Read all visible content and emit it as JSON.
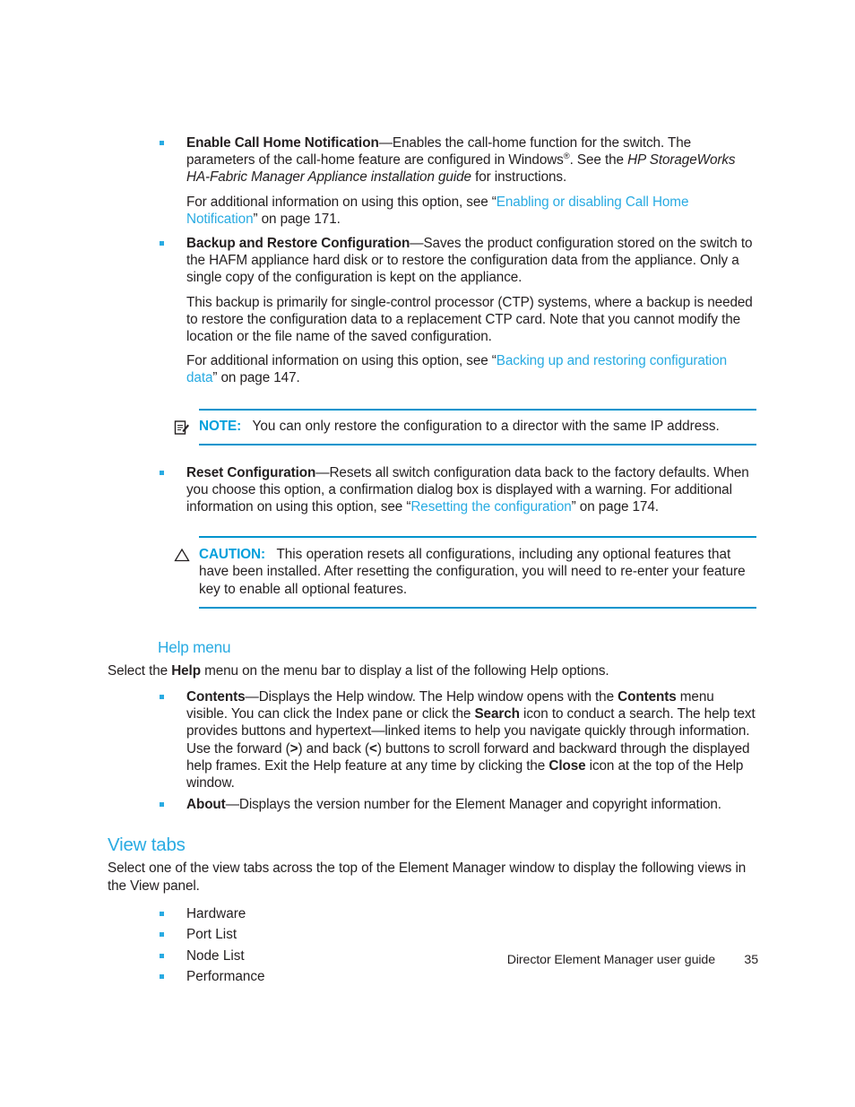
{
  "document": {
    "title": "Director Element Manager user guide",
    "page_number": "35"
  },
  "colors": {
    "link": "#29abe2",
    "heading": "#29abe2",
    "admonition_label": "#00a0dc",
    "rule": "#0094cd",
    "bullet": "#29abe2",
    "body_text": "#231f20"
  },
  "bullets": {
    "enable_call_home": {
      "term": "Enable Call Home Notification",
      "dash": "—",
      "p1_a": "Enables the call-home function for the switch. The parameters of the call-home feature are configured in Windows",
      "p1_sup": "®",
      "p1_b": ". See the ",
      "p1_italic": "HP StorageWorks HA-Fabric Manager Appliance installation guide",
      "p1_c": " for instructions.",
      "p2_a": "For additional information on using this option, see “",
      "p2_link": "Enabling or disabling Call Home Notification",
      "p2_b": "” on page 171."
    },
    "backup_restore": {
      "term": "Backup and Restore Configuration",
      "dash": "—",
      "p1": "Saves the product configuration stored on the switch to the HAFM appliance hard disk or to restore the configuration data from the appliance. Only a single copy of the configuration is kept on the appliance.",
      "p2": "This backup is primarily for single-control processor (CTP) systems, where a backup is needed to restore the configuration data to a replacement CTP card. Note that you cannot modify the location or the file name of the saved configuration.",
      "p3_a": "For additional information on using this option, see “",
      "p3_link": "Backing up and restoring configuration data",
      "p3_b": "” on page 147."
    },
    "reset_configuration": {
      "term": "Reset Configuration",
      "dash": "—",
      "p1_a": "Resets all switch configuration data back to the factory defaults. When you choose this option, a confirmation dialog box is displayed with a warning. For additional information on using this option, see “",
      "p1_link": "Resetting the configuration",
      "p1_b": "” on page 174."
    }
  },
  "note": {
    "icon": "note-document-pencil-icon",
    "label": "NOTE:",
    "text": "You can only restore the configuration to a director with the same IP address."
  },
  "caution": {
    "icon": "caution-triangle-icon",
    "label": "CAUTION:",
    "text": "This operation resets all configurations, including any optional features that have been installed. After resetting the configuration, you will need to re-enter your feature key to enable all optional features."
  },
  "help_menu": {
    "heading": "Help menu",
    "intro_a": "Select the ",
    "intro_bold": "Help",
    "intro_b": " menu on the menu bar to display a list of the following Help options.",
    "contents": {
      "term": "Contents",
      "dash": "—",
      "t1": "Displays the Help window. The Help window opens with the ",
      "b1": "Contents",
      "t2": " menu visible. You can click the Index pane or click the ",
      "b2": "Search",
      "t3": " icon to conduct a search. The help text provides buttons and hypertext—linked items to help you navigate quickly through information. Use the forward (",
      "b3": ">",
      "t4": ") and back (",
      "b4": "<",
      "t5": ") buttons to scroll forward and backward through the displayed help frames. Exit the Help feature at any time by clicking the ",
      "b5": "Close",
      "t6": " icon at the top of the Help window."
    },
    "about": {
      "term": "About",
      "dash": "—",
      "text": "Displays the version number for the Element Manager and copyright information."
    }
  },
  "view_tabs": {
    "heading": "View tabs",
    "intro": "Select one of the view tabs across the top of the Element Manager window to display the following views in the View panel.",
    "items": [
      "Hardware",
      "Port List",
      "Node List",
      "Performance"
    ]
  }
}
